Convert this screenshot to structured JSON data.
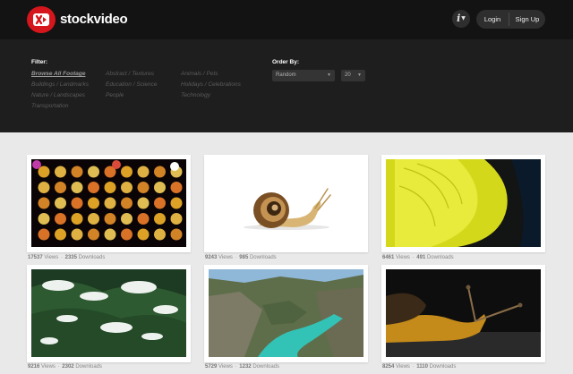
{
  "brand": {
    "name": "stockvideo",
    "accent": "#d5161c"
  },
  "header": {
    "info_label": "i",
    "login_label": "Login",
    "signup_label": "Sign Up"
  },
  "filter": {
    "title": "Filter:",
    "columns": [
      [
        "Browse All Footage",
        "Buildings / Landmarks",
        "Nature / Landscapes",
        "Transportation"
      ],
      [
        "Abstract / Textures",
        "Education / Science",
        "People"
      ],
      [
        "Animals / Pets",
        "Holidays / Celebrations",
        "Technology"
      ]
    ],
    "active": "Browse All Footage"
  },
  "order": {
    "title": "Order By:",
    "selected": "Random",
    "per_page": "20"
  },
  "videos": [
    {
      "subject": "bokeh lights",
      "views": "17537",
      "downloads": "2335"
    },
    {
      "subject": "snail on white",
      "views": "9243",
      "downloads": "985"
    },
    {
      "subject": "yellow macro",
      "views": "6461",
      "downloads": "491"
    },
    {
      "subject": "snowy pine",
      "views": "9216",
      "downloads": "2302"
    },
    {
      "subject": "river canyon",
      "views": "5729",
      "downloads": "1232"
    },
    {
      "subject": "snail closeup",
      "views": "8254",
      "downloads": "1110"
    }
  ],
  "labels": {
    "views": "Views",
    "downloads": "Downloads",
    "separator": "·"
  }
}
